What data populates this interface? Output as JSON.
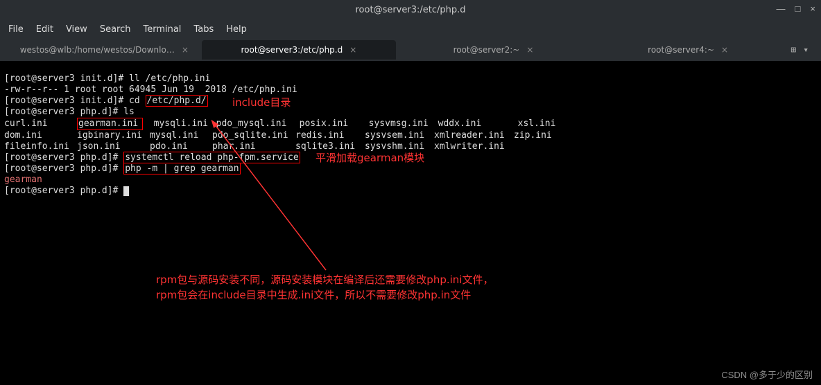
{
  "window": {
    "title": "root@server3:/etc/php.d",
    "min_icon": "—",
    "max_icon": "□",
    "close_icon": "×"
  },
  "menu": {
    "file": "File",
    "edit": "Edit",
    "view": "View",
    "search": "Search",
    "terminal": "Terminal",
    "tabs": "Tabs",
    "help": "Help"
  },
  "tabs": {
    "t0": "westos@wlb:/home/westos/Downlo…",
    "t1": "root@server3:/etc/php.d",
    "t2": "root@server2:~",
    "t3": "root@server4:~",
    "close": "×",
    "newtab": "⊞",
    "menu": "▾"
  },
  "term": {
    "l1_prompt": "[root@server3 init.d]# ",
    "l1_cmd": "ll /etc/php.ini",
    "l2": "-rw-r--r-- 1 root root 64945 Jun 19  2018 /etc/php.ini",
    "l3_prompt": "[root@server3 init.d]# ",
    "l3_cmd_a": "cd ",
    "l3_cmd_b": "/etc/php.d/",
    "l4_prompt": "[root@server3 php.d]# ",
    "l4_cmd": "ls",
    "ls_row1_c1": "curl.ini",
    "ls_row1_c2": "gearman.ini",
    "ls_row1_c3": "mysqli.ini",
    "ls_row1_c4": "pdo_mysql.ini",
    "ls_row1_c5": "posix.ini",
    "ls_row1_c6": "sysvmsg.ini",
    "ls_row1_c7": "wddx.ini",
    "ls_row1_c8": "xsl.ini",
    "ls_row2_c1": "dom.ini",
    "ls_row2_c2": "igbinary.ini",
    "ls_row2_c3": "mysql.ini",
    "ls_row2_c4": "pdo_sqlite.ini",
    "ls_row2_c5": "redis.ini",
    "ls_row2_c6": "sysvsem.ini",
    "ls_row2_c7": "xmlreader.ini",
    "ls_row2_c8": "zip.ini",
    "ls_row3_c1": "fileinfo.ini",
    "ls_row3_c2": "json.ini",
    "ls_row3_c3": "pdo.ini",
    "ls_row3_c4": "phar.ini",
    "ls_row3_c5": "sqlite3.ini",
    "ls_row3_c6": "sysvshm.ini",
    "ls_row3_c7": "xmlwriter.ini",
    "l8_prompt": "[root@server3 php.d]# ",
    "l8_cmd": "systemctl reload php-fpm.service",
    "l9_prompt": "[root@server3 php.d]# ",
    "l9_cmd": "php -m | grep gearman",
    "l10": "gearman",
    "l11_prompt": "[root@server3 php.d]# "
  },
  "annotations": {
    "include": "include目录",
    "reload": "平滑加载gearman模块",
    "rpm_line1": "rpm包与源码安装不同，源码安装模块在编译后还需要修改php.ini文件，",
    "rpm_line2": "rpm包会在include目录中生成.ini文件，所以不需要修改php.in文件"
  },
  "watermark": "CSDN @多于少的区别"
}
